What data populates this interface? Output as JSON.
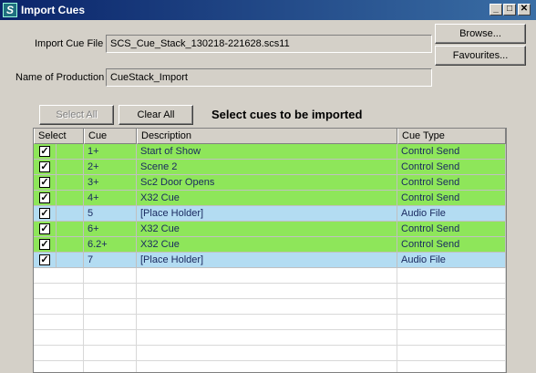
{
  "window": {
    "title": "Import Cues",
    "app_icon": "S"
  },
  "form": {
    "file_label": "Import Cue File",
    "file_value": "SCS_Cue_Stack_130218-221628.scs11",
    "production_label": "Name of Production",
    "production_value": "CueStack_Import"
  },
  "buttons": {
    "browse": "Browse...",
    "favourites": "Favourites...",
    "select_all": "Select All",
    "clear_all": "Clear All"
  },
  "heading": "Select cues to be imported",
  "columns": [
    "Select",
    "Cue",
    "Description",
    "Cue Type"
  ],
  "rows": [
    {
      "checked": true,
      "cue": "1+",
      "description": "Start of Show",
      "type": "Control Send",
      "color": "green"
    },
    {
      "checked": true,
      "cue": "2+",
      "description": "Scene 2",
      "type": "Control Send",
      "color": "green"
    },
    {
      "checked": true,
      "cue": "3+",
      "description": "Sc2 Door Opens",
      "type": "Control Send",
      "color": "green"
    },
    {
      "checked": true,
      "cue": "4+",
      "description": "X32 Cue",
      "type": "Control Send",
      "color": "green"
    },
    {
      "checked": true,
      "cue": "5",
      "description": "[Place Holder]",
      "type": "Audio File",
      "color": "blue"
    },
    {
      "checked": true,
      "cue": "6+",
      "description": "X32 Cue",
      "type": "Control Send",
      "color": "green"
    },
    {
      "checked": true,
      "cue": "6.2+",
      "description": "X32 Cue",
      "type": "Control Send",
      "color": "green"
    },
    {
      "checked": true,
      "cue": "7",
      "description": "[Place Holder]",
      "type": "Audio File",
      "color": "blue"
    }
  ],
  "empty_rows": 7,
  "colors": {
    "control_send": "#8ee65a",
    "audio_file": "#b3dcf2",
    "titlebar": "#0a246a"
  }
}
